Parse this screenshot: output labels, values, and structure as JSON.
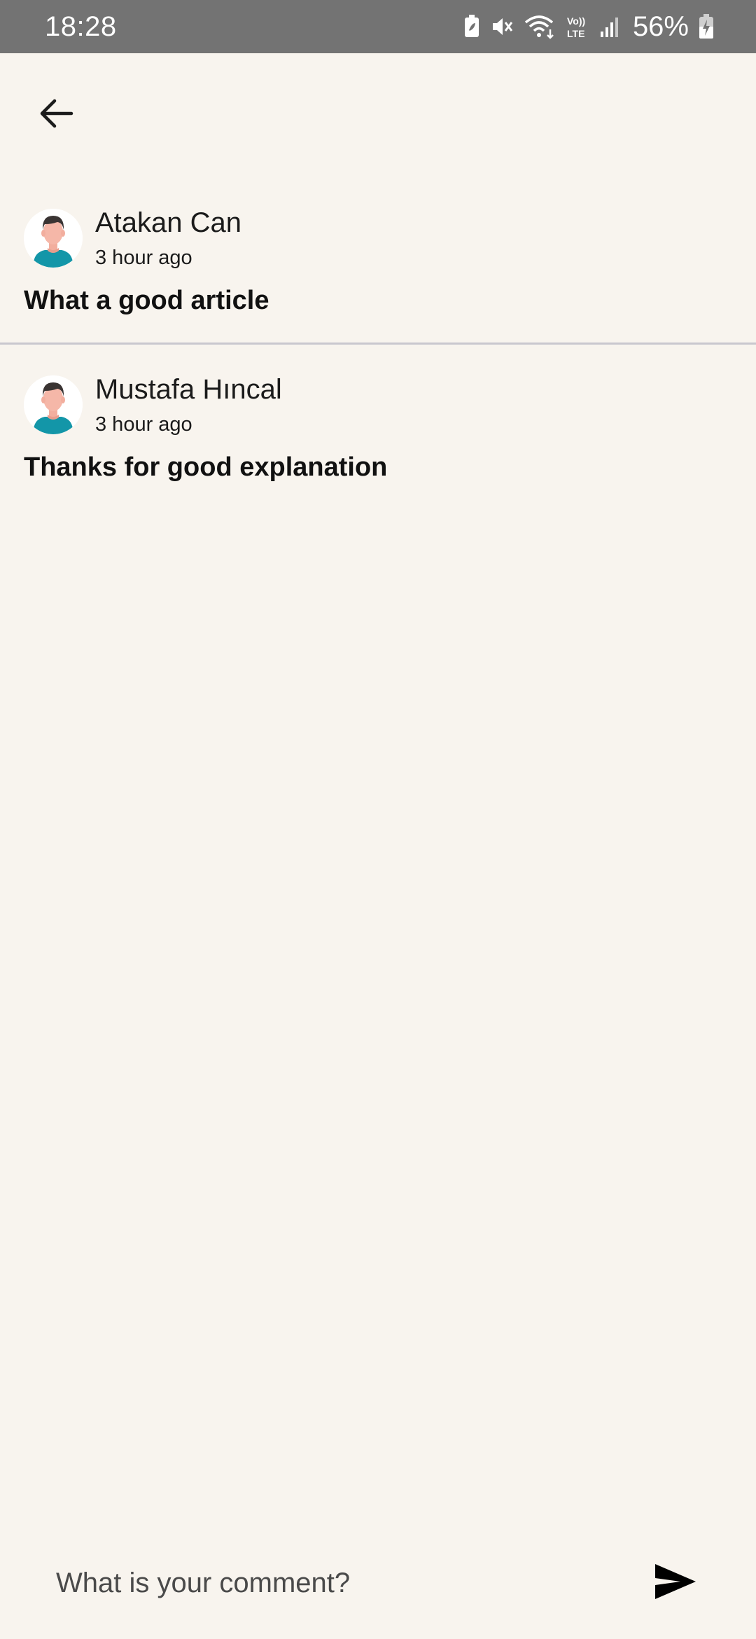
{
  "status_bar": {
    "time": "18:28",
    "battery": "56%",
    "icons": [
      "battery-saver-icon",
      "mute-icon",
      "wifi-icon",
      "volte-icon",
      "signal-icon",
      "battery-charging-icon"
    ],
    "network_label_top": "Vo))",
    "network_label_bottom": "LTE"
  },
  "header": {
    "back_icon": "arrow-left-icon"
  },
  "comments": [
    {
      "author": "Atakan Can",
      "time": "3 hour ago",
      "text": "What a good article",
      "avatar_icon": "user-avatar-icon"
    },
    {
      "author": "Mustafa Hıncal",
      "time": "3 hour ago",
      "text": "Thanks for good explanation",
      "avatar_icon": "user-avatar-icon"
    }
  ],
  "composer": {
    "placeholder": "What is your comment?",
    "value": "",
    "send_icon": "send-icon"
  },
  "colors": {
    "background": "#F8F4EE",
    "status_bar": "#737373",
    "divider": "#C9C7CE",
    "avatar_shirt": "#1396A8",
    "avatar_skin": "#F5B7A8",
    "avatar_hair": "#3A3433"
  }
}
